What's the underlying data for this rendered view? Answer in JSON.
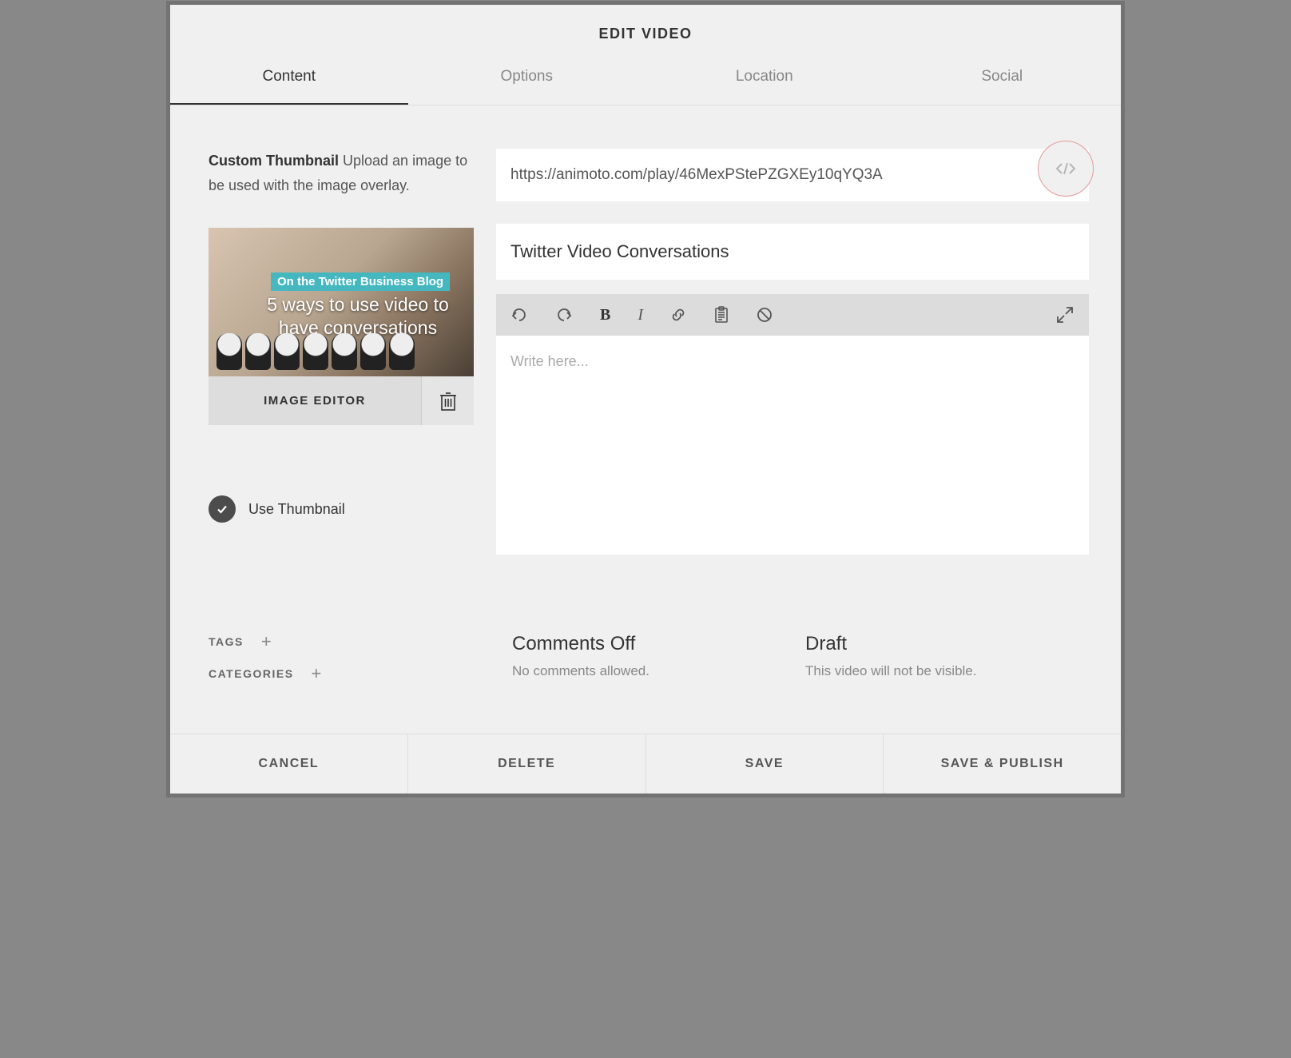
{
  "modal": {
    "title": "EDIT VIDEO"
  },
  "tabs": [
    {
      "label": "Content",
      "active": true
    },
    {
      "label": "Options",
      "active": false
    },
    {
      "label": "Location",
      "active": false
    },
    {
      "label": "Social",
      "active": false
    }
  ],
  "thumbnail": {
    "label_strong": "Custom Thumbnail",
    "label_rest": " Upload an image to be used with the image overlay.",
    "overlay_band": "On the Twitter Business Blog",
    "overlay_main": "5 ways to use video to have conversations",
    "image_editor_label": "IMAGE EDITOR",
    "use_thumbnail_label": "Use Thumbnail"
  },
  "video": {
    "url_value": "https://animoto.com/play/46MexPStePZGXEy10qYQ3A",
    "title_value": "Twitter Video Conversations",
    "description_placeholder": "Write here..."
  },
  "meta": {
    "tags_label": "TAGS",
    "categories_label": "CATEGORIES",
    "comments_title": "Comments Off",
    "comments_sub": "No comments allowed.",
    "draft_title": "Draft",
    "draft_sub": "This video will not be visible."
  },
  "footer": {
    "cancel": "CANCEL",
    "delete": "DELETE",
    "save": "SAVE",
    "save_publish": "SAVE & PUBLISH"
  }
}
